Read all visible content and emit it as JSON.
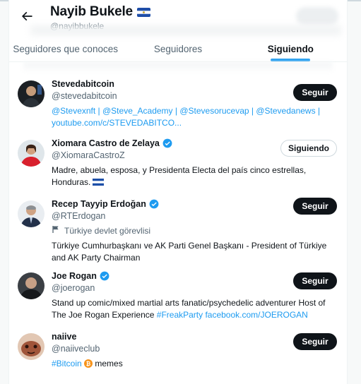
{
  "header": {
    "title": "Nayib Bukele",
    "handle": "@nayibbukele",
    "back_icon": "arrow-left-icon",
    "title_flag_icon": "el-salvador-flag-icon"
  },
  "tabs": [
    {
      "label": "Seguidores que conoces",
      "active": false
    },
    {
      "label": "Seguidores",
      "active": false
    },
    {
      "label": "Siguiendo",
      "active": true
    }
  ],
  "colors": {
    "accent": "#1d9bf0",
    "text": "#0f1419",
    "muted": "#536471"
  },
  "users": [
    {
      "name": "Stevedabitcoin",
      "handle": "@stevedabitcoin",
      "button": "Seguir",
      "bio_line1": "@Stevexnft | @Steve_Academy | @Stevesorucevap | @Stevedanews |",
      "bio_line2": "youtube.com/c/STEVEDABITCO..."
    },
    {
      "name": "Xiomara Castro de Zelaya",
      "handle": "@XiomaraCastroZ",
      "button": "Siguiendo",
      "bio_line1": "Madre, abuela, esposa, y Presidenta Electa del país cinco estrellas,",
      "bio_line2": "Honduras."
    },
    {
      "name": "Recep Tayyip Erdoğan",
      "handle": "@RTErdogan",
      "button": "Seguir",
      "label": "Türkiye devlet görevlisi",
      "bio_line1": "Türkiye Cumhurbaşkanı ve AK Parti Genel Başkanı - President of Türkiye",
      "bio_line2": "and AK Party Chairman"
    },
    {
      "name": "Joe Rogan",
      "handle": "@joerogan",
      "button": "Seguir",
      "bio_line1": "Stand up comic/mixed martial arts fanatic/psychedelic adventurer Host of",
      "bio_line2_pre": "The Joe Rogan Experience ",
      "bio_line2_link": "#FreakParty facebook.com/JOEROGAN"
    },
    {
      "name": "naiive",
      "handle": "@naiiveclub",
      "button": "Seguir",
      "bio_link": "#Bitcoin",
      "bio_rest": " memes"
    }
  ]
}
